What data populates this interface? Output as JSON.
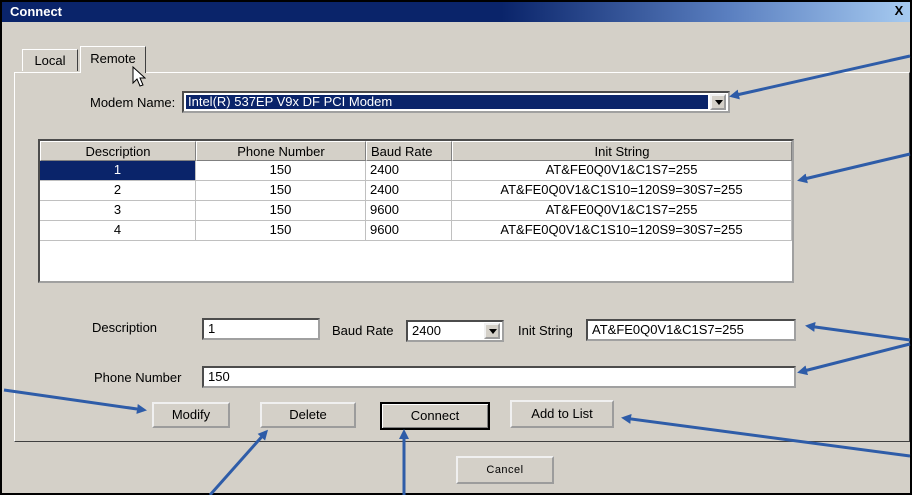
{
  "window": {
    "title": "Connect",
    "close_glyph": "X"
  },
  "tabs": [
    {
      "label": "Local"
    },
    {
      "label": "Remote"
    }
  ],
  "modem": {
    "label": "Modem Name:",
    "selected": "Intel(R) 537EP V9x DF PCI Modem"
  },
  "table": {
    "columns": [
      "Description",
      "Phone Number",
      "Baud Rate",
      "Init String"
    ],
    "rows": [
      [
        "1",
        "150",
        "2400",
        "AT&FE0Q0V1&C1S7=255"
      ],
      [
        "2",
        "150",
        "2400",
        "AT&FE0Q0V1&C1S10=120S9=30S7=255"
      ],
      [
        "3",
        "150",
        "9600",
        "AT&FE0Q0V1&C1S7=255"
      ],
      [
        "4",
        "150",
        "9600",
        "AT&FE0Q0V1&C1S10=120S9=30S7=255"
      ]
    ]
  },
  "form": {
    "description_label": "Description",
    "description_value": "1",
    "baud_label": "Baud Rate",
    "baud_value": "2400",
    "init_label": "Init String",
    "init_value": "AT&FE0Q0V1&C1S7=255",
    "phone_label": "Phone Number",
    "phone_value": "150"
  },
  "buttons": {
    "modify": "Modify",
    "delete": "Delete",
    "connect": "Connect",
    "add_to_list": "Add to List",
    "cancel": "Cancel"
  },
  "colors": {
    "annotation_arrow": "#2e5ca8",
    "selection": "#0a246a",
    "dialog_face": "#d4d0c8"
  },
  "icons": [
    "close-icon",
    "dropdown-arrow-icon",
    "mouse-pointer-icon"
  ]
}
